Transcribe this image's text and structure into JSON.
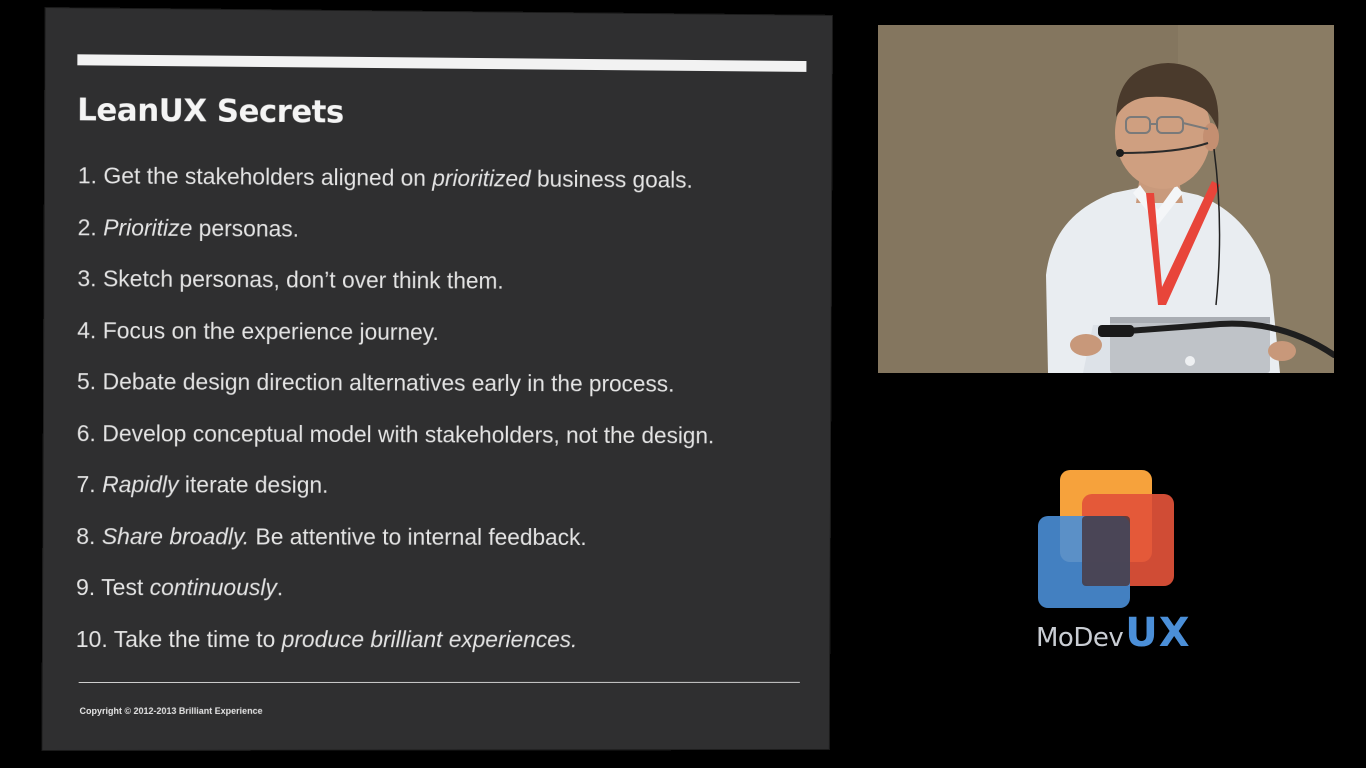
{
  "slide": {
    "title": "LeanUX Secrets",
    "items": [
      {
        "number": "1.",
        "parts": [
          {
            "text": "Get the stakeholders aligned on ",
            "italic": false
          },
          {
            "text": "prioritized",
            "italic": true
          },
          {
            "text": " business goals.",
            "italic": false
          }
        ]
      },
      {
        "number": "2.",
        "parts": [
          {
            "text": "Prioritize",
            "italic": true
          },
          {
            "text": " personas.",
            "italic": false
          }
        ]
      },
      {
        "number": "3.",
        "parts": [
          {
            "text": "Sketch personas, don’t over think them.",
            "italic": false
          }
        ]
      },
      {
        "number": "4.",
        "parts": [
          {
            "text": "Focus on the experience journey.",
            "italic": false
          }
        ]
      },
      {
        "number": "5.",
        "parts": [
          {
            "text": "Debate design direction alternatives early in the process.",
            "italic": false
          }
        ]
      },
      {
        "number": "6.",
        "parts": [
          {
            "text": "Develop conceptual model with stakeholders, not the design.",
            "italic": false
          }
        ]
      },
      {
        "number": "7.",
        "parts": [
          {
            "text": "Rapidly",
            "italic": true
          },
          {
            "text": " iterate design.",
            "italic": false
          }
        ]
      },
      {
        "number": "8.",
        "parts": [
          {
            "text": "Share broadly.",
            "italic": true
          },
          {
            "text": "  Be attentive to internal feedback.",
            "italic": false
          }
        ]
      },
      {
        "number": "9.",
        "parts": [
          {
            "text": "Test ",
            "italic": false
          },
          {
            "text": "continuously",
            "italic": true
          },
          {
            "text": ".",
            "italic": false
          }
        ]
      },
      {
        "number": "10.",
        "parts": [
          {
            "text": "Take the time to ",
            "italic": false
          },
          {
            "text": "produce brilliant experiences.",
            "italic": true
          }
        ]
      }
    ],
    "footer": "Copyright © 2012-2013 Brilliant Experience"
  },
  "logo": {
    "name_part1": "MoDev",
    "name_part2": "UX",
    "colors": {
      "orange": "#f6a23c",
      "red": "#e2533a",
      "blue": "#4a8ed6",
      "text": "#c9cdd3"
    }
  },
  "colors": {
    "slide_background": "#2f2f30",
    "page_background": "#000000",
    "lanyard": "#e8453a"
  }
}
